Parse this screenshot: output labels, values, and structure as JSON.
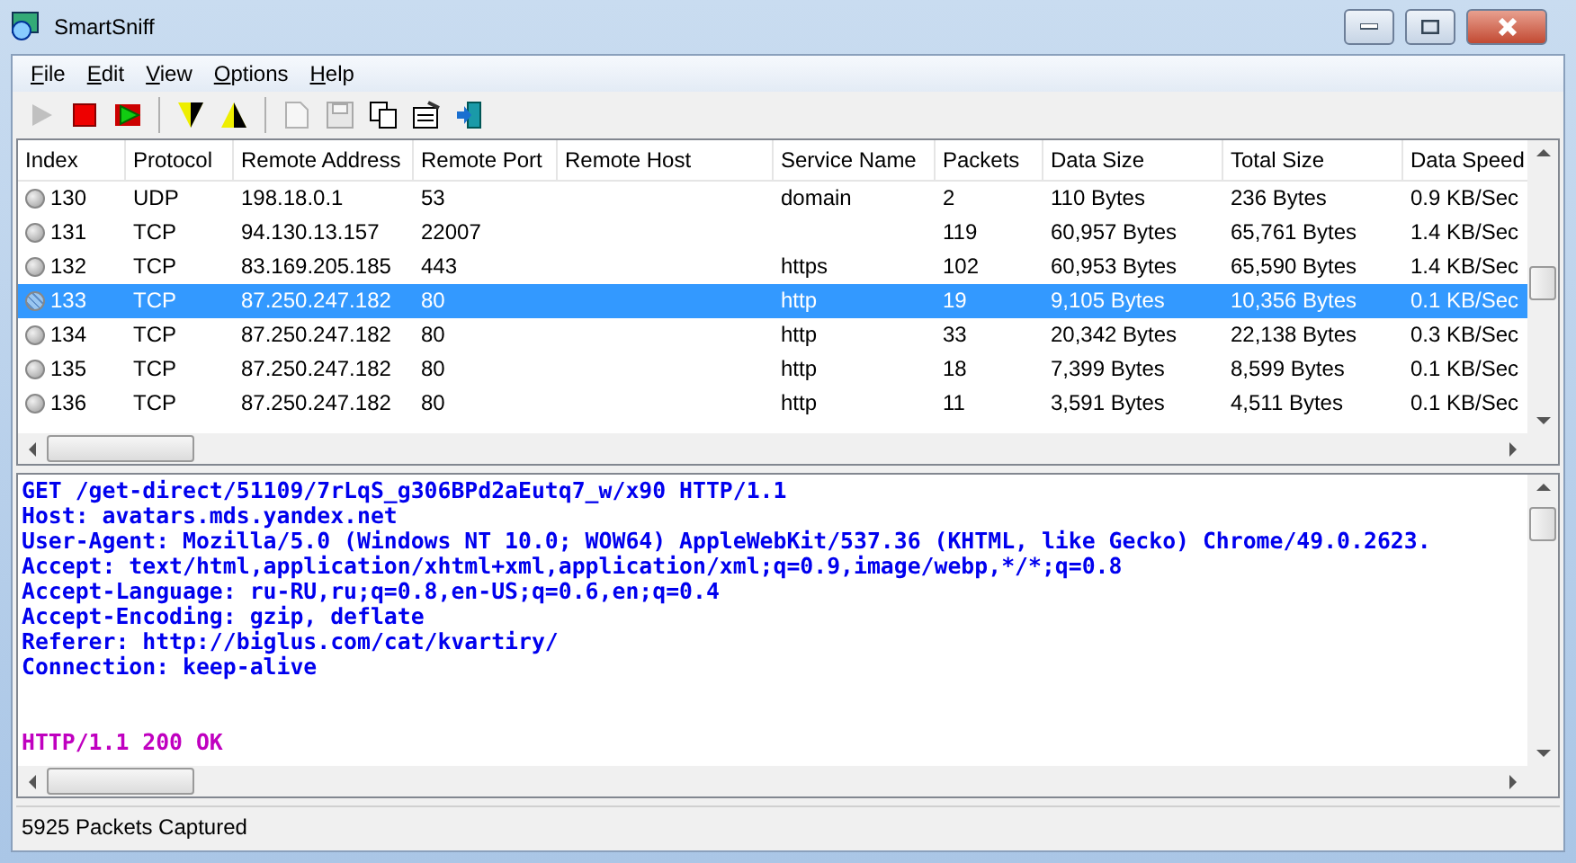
{
  "window": {
    "title": "SmartSniff"
  },
  "menu": [
    {
      "label": "File"
    },
    {
      "label": "Edit"
    },
    {
      "label": "View"
    },
    {
      "label": "Options"
    },
    {
      "label": "Help"
    }
  ],
  "toolbar": [
    {
      "kind": "play",
      "disabled": true
    },
    {
      "kind": "stop",
      "disabled": false
    },
    {
      "kind": "resume",
      "disabled": false
    },
    {
      "kind": "sep"
    },
    {
      "kind": "filter-down",
      "disabled": false
    },
    {
      "kind": "filter-up",
      "disabled": false
    },
    {
      "kind": "sep"
    },
    {
      "kind": "doc",
      "disabled": true
    },
    {
      "kind": "save",
      "disabled": true
    },
    {
      "kind": "copy",
      "disabled": false
    },
    {
      "kind": "props",
      "disabled": false
    },
    {
      "kind": "exit",
      "disabled": false
    }
  ],
  "table": {
    "columns": [
      "Index",
      "Protocol",
      "Remote Address",
      "Remote Port",
      "Remote Host",
      "Service Name",
      "Packets",
      "Data Size",
      "Total Size",
      "Data Speed"
    ],
    "rows": [
      {
        "selected": false,
        "cells": [
          "130",
          "UDP",
          "198.18.0.1",
          "53",
          "",
          "domain",
          "2",
          "110 Bytes",
          "236 Bytes",
          "0.9 KB/Sec"
        ]
      },
      {
        "selected": false,
        "cells": [
          "131",
          "TCP",
          "94.130.13.157",
          "22007",
          "",
          "",
          "119",
          "60,957 Bytes",
          "65,761 Bytes",
          "1.4 KB/Sec"
        ]
      },
      {
        "selected": false,
        "cells": [
          "132",
          "TCP",
          "83.169.205.185",
          "443",
          "",
          "https",
          "102",
          "60,953 Bytes",
          "65,590 Bytes",
          "1.4 KB/Sec"
        ]
      },
      {
        "selected": true,
        "cells": [
          "133",
          "TCP",
          "87.250.247.182",
          "80",
          "",
          "http",
          "19",
          "9,105 Bytes",
          "10,356 Bytes",
          "0.1 KB/Sec"
        ]
      },
      {
        "selected": false,
        "cells": [
          "134",
          "TCP",
          "87.250.247.182",
          "80",
          "",
          "http",
          "33",
          "20,342 Bytes",
          "22,138 Bytes",
          "0.3 KB/Sec"
        ]
      },
      {
        "selected": false,
        "cells": [
          "135",
          "TCP",
          "87.250.247.182",
          "80",
          "",
          "http",
          "18",
          "7,399 Bytes",
          "8,599 Bytes",
          "0.1 KB/Sec"
        ]
      },
      {
        "selected": false,
        "cells": [
          "136",
          "TCP",
          "87.250.247.182",
          "80",
          "",
          "http",
          "11",
          "3,591 Bytes",
          "4,511 Bytes",
          "0.1 KB/Sec"
        ]
      }
    ]
  },
  "stream": [
    {
      "kind": "request",
      "text": "GET /get-direct/51109/7rLqS_g306BPd2aEutq7_w/x90 HTTP/1.1"
    },
    {
      "kind": "request",
      "text": "Host: avatars.mds.yandex.net"
    },
    {
      "kind": "request",
      "text": "User-Agent: Mozilla/5.0 (Windows NT 10.0; WOW64) AppleWebKit/537.36 (KHTML, like Gecko) Chrome/49.0.2623."
    },
    {
      "kind": "request",
      "text": "Accept: text/html,application/xhtml+xml,application/xml;q=0.9,image/webp,*/*;q=0.8"
    },
    {
      "kind": "request",
      "text": "Accept-Language: ru-RU,ru;q=0.8,en-US;q=0.6,en;q=0.4"
    },
    {
      "kind": "request",
      "text": "Accept-Encoding: gzip, deflate"
    },
    {
      "kind": "request",
      "text": "Referer: http://biglus.com/cat/kvartiry/"
    },
    {
      "kind": "request",
      "text": "Connection: keep-alive"
    },
    {
      "kind": "blank"
    },
    {
      "kind": "blank"
    },
    {
      "kind": "response",
      "text": "HTTP/1.1 200 OK"
    }
  ],
  "status_bar": "5925 Packets Captured"
}
